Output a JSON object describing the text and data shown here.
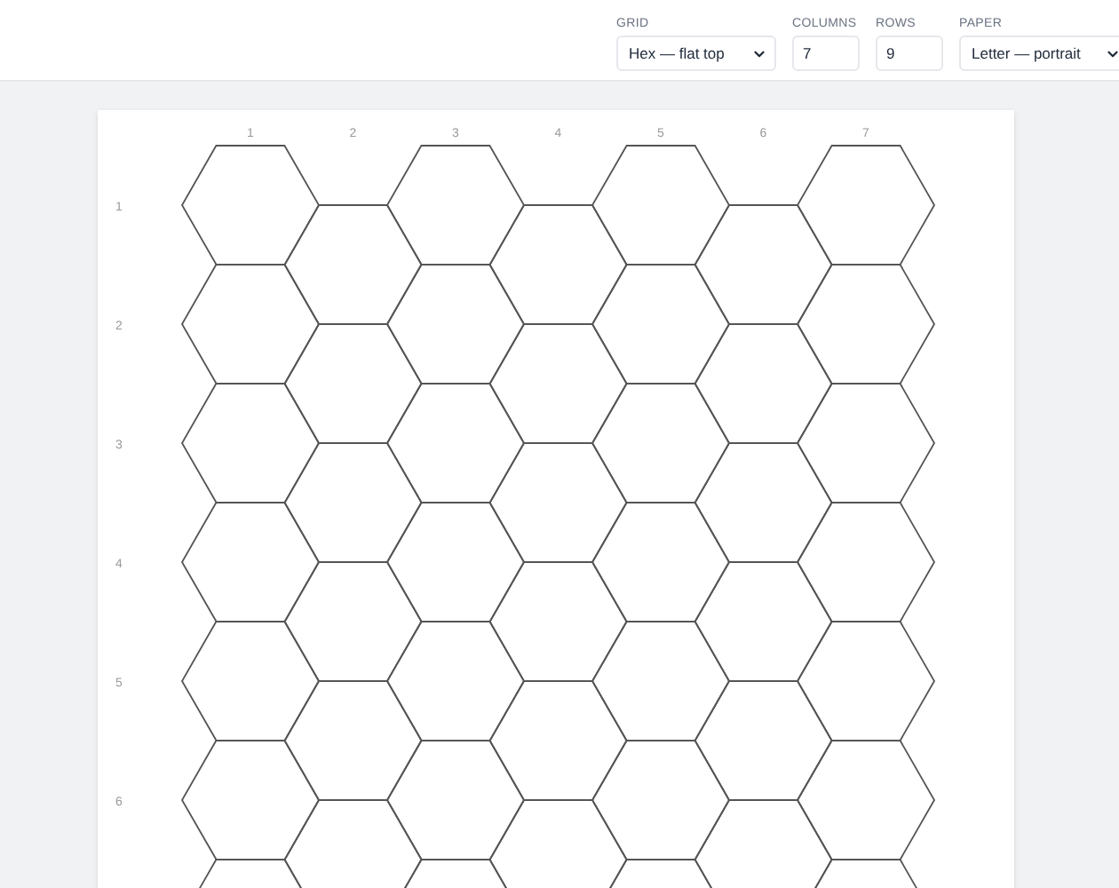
{
  "toolbar": {
    "grid": {
      "label": "GRID",
      "value": "Hex — flat top"
    },
    "columns": {
      "label": "COLUMNS",
      "value": "7"
    },
    "rows": {
      "label": "ROWS",
      "value": "9"
    },
    "paper": {
      "label": "PAPER",
      "value": "Letter — portrait"
    }
  },
  "sheet": {
    "column_labels": [
      "1",
      "2",
      "3",
      "4",
      "5",
      "6",
      "7"
    ],
    "row_labels": [
      "1",
      "2",
      "3",
      "4",
      "5",
      "6"
    ]
  }
}
